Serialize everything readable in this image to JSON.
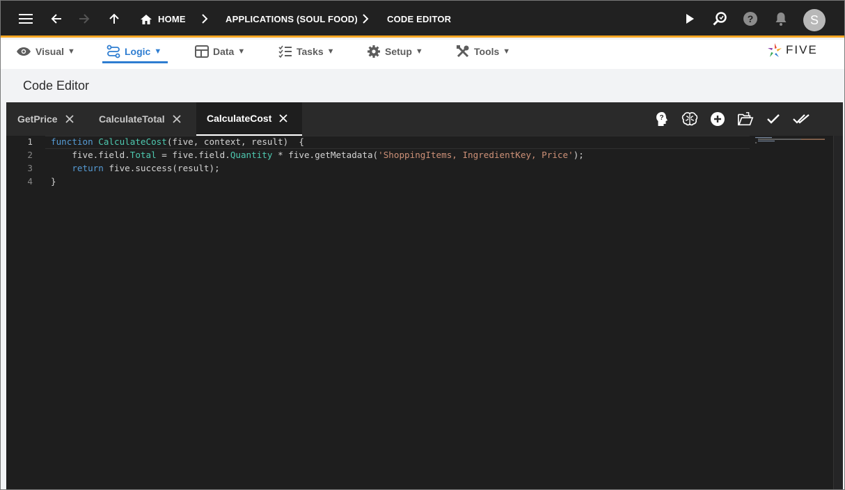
{
  "appbar": {
    "breadcrumbs": [
      "HOME",
      "APPLICATIONS (SOUL FOOD)",
      "CODE EDITOR"
    ],
    "avatar_letter": "S",
    "icons": [
      "menu-icon",
      "back-arrow-icon",
      "forward-arrow-icon",
      "up-arrow-icon",
      "home-icon",
      "play-icon",
      "search-icon",
      "help-icon",
      "bell-icon"
    ]
  },
  "menu": {
    "items": [
      {
        "label": "Visual",
        "icon": "eye-icon"
      },
      {
        "label": "Logic",
        "icon": "logic-icon",
        "active": true
      },
      {
        "label": "Data",
        "icon": "table-icon"
      },
      {
        "label": "Tasks",
        "icon": "tasks-icon"
      },
      {
        "label": "Setup",
        "icon": "gear-icon"
      },
      {
        "label": "Tools",
        "icon": "tools-icon"
      }
    ],
    "caret": "▼",
    "logo_text": "FIVE",
    "accent": "#2e7dd1"
  },
  "page": {
    "title": "Code Editor"
  },
  "editor": {
    "tabs": [
      {
        "label": "GetPrice"
      },
      {
        "label": "CalculateTotal"
      },
      {
        "label": "CalculateCost",
        "active": true
      }
    ],
    "toolbar_icons": [
      "ai-help-icon",
      "brain-icon",
      "add-icon",
      "open-folder-icon",
      "check-icon",
      "double-check-icon"
    ],
    "line_numbers": [
      "1",
      "2",
      "3",
      "4"
    ],
    "code": {
      "l1_kw": "function",
      "l1_fn": "CalculateCost",
      "l1_rest": "(five, context, result)  {",
      "l2_a": "    five.field.",
      "l2_total": "Total",
      "l2_b": " = five.field.",
      "l2_qty": "Quantity",
      "l2_c": " * five.getMetadata(",
      "l2_str": "'ShoppingItems, IngredientKey, Price'",
      "l2_d": ");",
      "l3_indent": "    ",
      "l3_kw": "return",
      "l3_rest": " five.success(result);",
      "l4": "}"
    }
  },
  "colors": {
    "appbar_bg": "#212121",
    "appbar_border": "#f5a623",
    "editor_bg": "#1e1e1e"
  }
}
